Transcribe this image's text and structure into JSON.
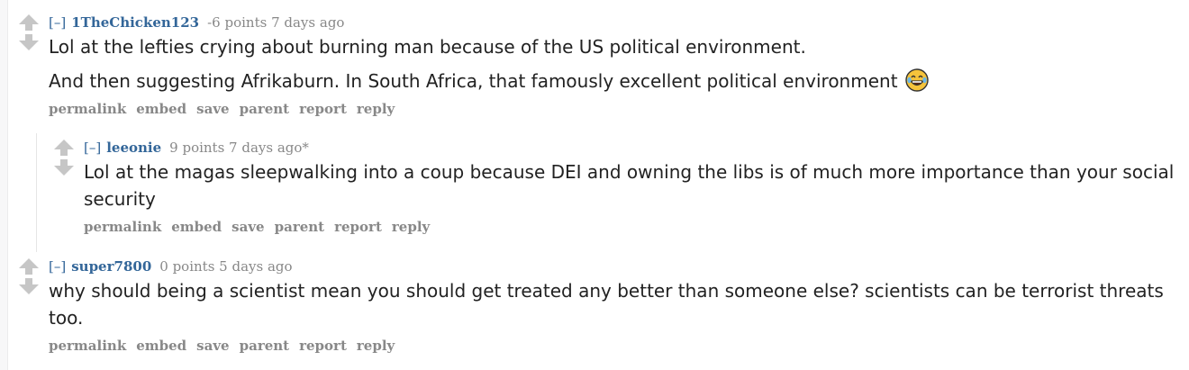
{
  "colors": {
    "author": "#336699",
    "meta": "#888888",
    "text": "#222222",
    "arrow": "#c6c6c6"
  },
  "comments": [
    {
      "toggle": "[–]",
      "author": "1TheChicken123",
      "score": "-6 points 7 days ago",
      "paragraphs": [
        "Lol at the lefties crying about burning man because of the US political environment.",
        "And then suggesting Afrikaburn. In South Africa, that famously excellent political environment"
      ],
      "emoji": "face-with-tears-of-joy-icon"
    },
    {
      "toggle": "[–]",
      "author": "leeonie",
      "score": "9 points 7 days ago*",
      "paragraphs": [
        "Lol at the magas sleepwalking into a coup because DEI and owning the libs is of much more importance than your social security"
      ]
    },
    {
      "toggle": "[–]",
      "author": "super7800",
      "score": "0 points 5 days ago",
      "paragraphs": [
        "why should being a scientist mean you should get treated any better than someone else? scientists can be terrorist threats too."
      ]
    }
  ],
  "actions": [
    "permalink",
    "embed",
    "save",
    "parent",
    "report",
    "reply"
  ]
}
